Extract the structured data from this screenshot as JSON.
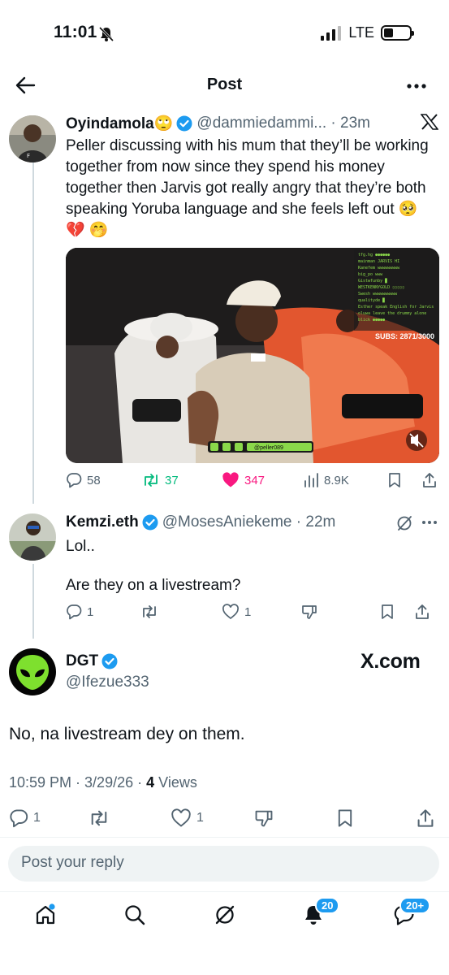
{
  "status_bar": {
    "time": "11:01",
    "network": "LTE"
  },
  "header": {
    "title": "Post"
  },
  "tweet1": {
    "name": "Oyindamola",
    "name_emoji": "🙄",
    "handle": "@dammiedammi...",
    "time": "23m",
    "text": "Peller discussing with his mum that they’ll be working together from now since they spend his money together then Jarvis got really angry that they’re both speaking Yoruba language and she feels left out 🥺 💔 🤭",
    "stats": {
      "replies": "58",
      "reposts": "37",
      "likes": "347",
      "views": "8.9K"
    },
    "media": {
      "subs": "SUBS: 2871/3000",
      "social": "@peller089"
    }
  },
  "tweet2": {
    "name": "Kemzi.eth",
    "handle": "@MosesAniekeme",
    "time": "22m",
    "text_line1": "Lol..",
    "text_line2": "Are they on a livestream?",
    "stats": {
      "replies": "1",
      "likes": "1"
    }
  },
  "main_tweet": {
    "name": "DGT",
    "handle": "@Ifezue333",
    "watermark": "X.com",
    "text": "No, na livestream dey on them.",
    "time": "10:59 PM",
    "date": "3/29/26",
    "views_count": "4",
    "views_label": "Views",
    "stats": {
      "replies": "1",
      "likes": "1"
    }
  },
  "reply": {
    "placeholder": "Post your reply"
  },
  "bottom_nav": {
    "notifications_badge": "20",
    "messages_badge": "20+"
  },
  "colors": {
    "accent": "#1d9bf0",
    "like": "#f91880",
    "repost": "#00ba7c",
    "muted": "#536471"
  }
}
